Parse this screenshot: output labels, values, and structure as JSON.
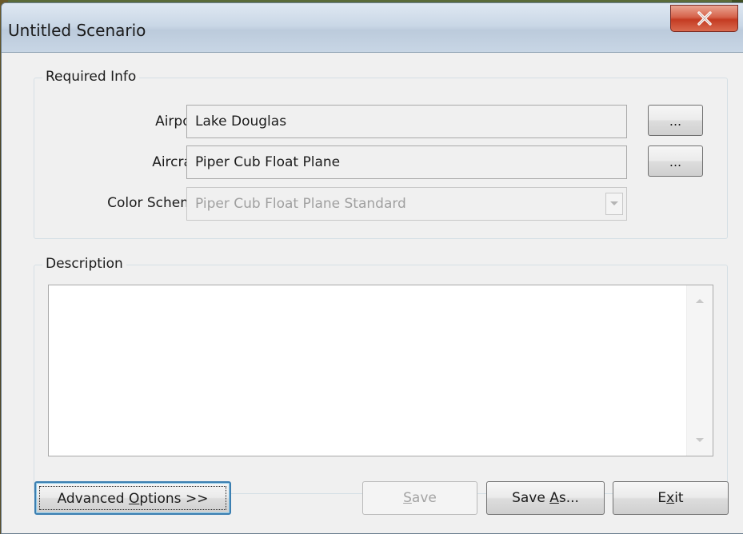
{
  "window": {
    "title": "Untitled Scenario",
    "close_glyph": "X"
  },
  "required_info": {
    "legend": "Required Info",
    "airport": {
      "label": "Airport:",
      "value": "Lake Douglas",
      "browse_label": "..."
    },
    "aircraft": {
      "label": "Aircraft:",
      "value": "Piper Cub Float Plane",
      "browse_label": "..."
    },
    "color_scheme": {
      "label": "Color Scheme:",
      "value": "Piper Cub Float Plane Standard",
      "enabled": false
    }
  },
  "description": {
    "legend": "Description",
    "text": ""
  },
  "buttons": {
    "advanced": {
      "pre": "Advanced ",
      "accel": "O",
      "post": "ptions >>"
    },
    "save": {
      "pre": "",
      "accel": "S",
      "post": "ave",
      "enabled": false
    },
    "save_as": {
      "pre": "Save ",
      "accel": "A",
      "post": "s..."
    },
    "exit": {
      "pre": "E",
      "accel": "x",
      "post": "it"
    }
  },
  "colors": {
    "close_red": "#c43b22",
    "focus_blue": "#3c7fb1",
    "disabled_text": "#a0a0a0"
  },
  "icons": {
    "close": "close-icon",
    "dropdown": "chevron-down-icon",
    "scroll_up": "scroll-up-arrow-icon",
    "scroll_down": "scroll-down-arrow-icon"
  }
}
